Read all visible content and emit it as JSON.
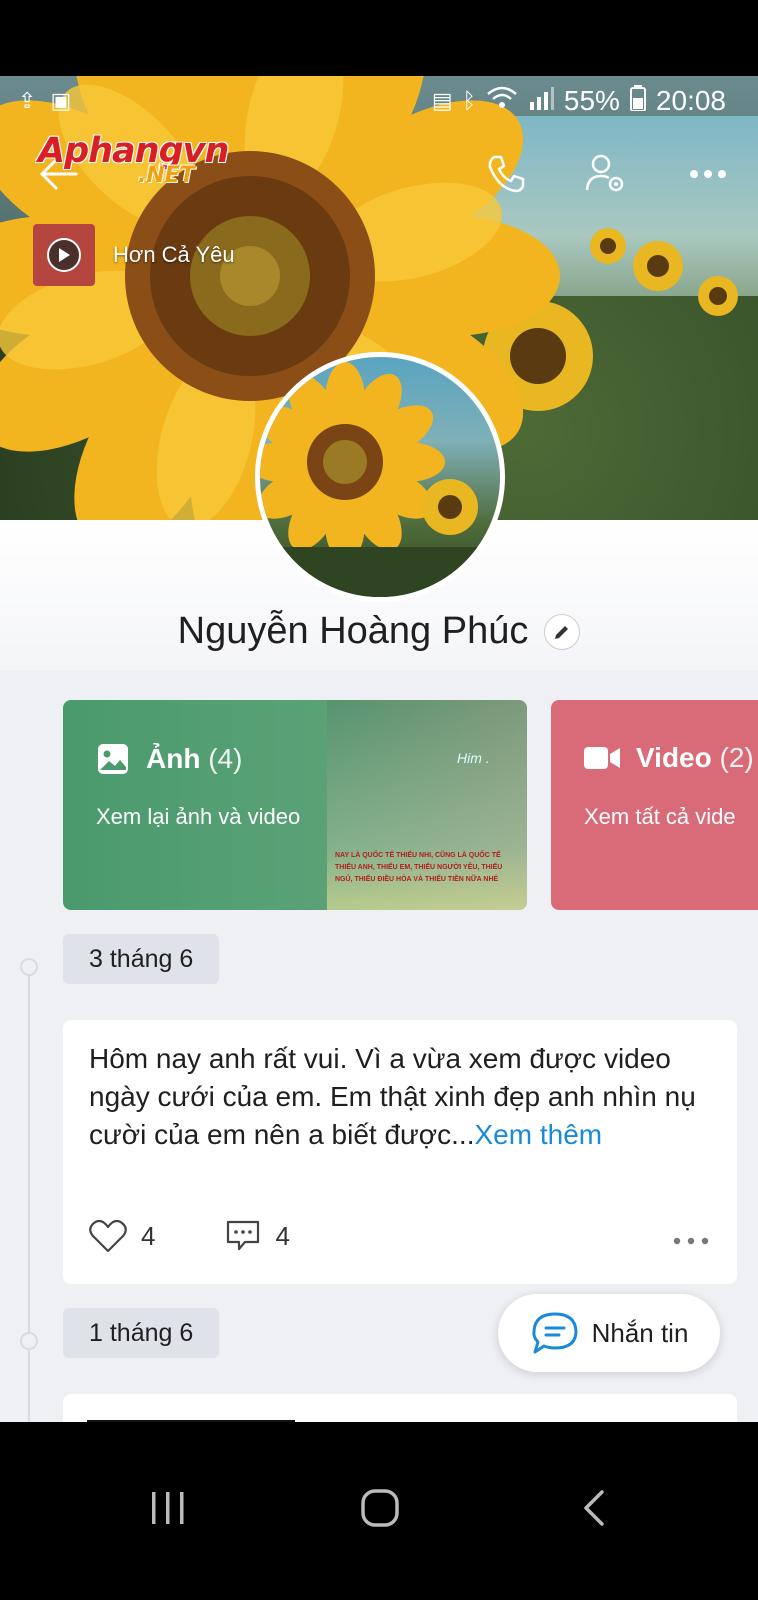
{
  "watermark": {
    "line1": "Aphangvn",
    "line2": ".NET"
  },
  "status_bar": {
    "battery": "55%",
    "time": "20:08"
  },
  "header": {
    "back_icon": "arrow-left-icon",
    "call_icon": "phone-icon",
    "settings_icon": "user-settings-icon",
    "more_icon": "more-icon"
  },
  "music": {
    "title": "Hơn Cả Yêu",
    "thumb_text": "Hơn Cả Yêu"
  },
  "profile": {
    "name": "Nguyễn Hoàng Phúc"
  },
  "cards": [
    {
      "title": "Ảnh",
      "count": "(4)",
      "subtitle": "Xem lại ảnh và video",
      "icon": "image-icon",
      "color": "#4a9a6e",
      "overlay_text": "Him .",
      "overlay_caption": "NAY LÀ QUỐC TẾ THIẾU NHI, CŨNG LÀ QUỐC TẾ THIẾU ANH, THIẾU EM, THIẾU NGƯỜI YÊU, THIẾU NGỦ, THIẾU ĐIỀU HÒA VÀ THIẾU TIỀN NỮA NHÉ"
    },
    {
      "title": "Video",
      "count": "(2)",
      "subtitle": "Xem tất cả vide",
      "icon": "video-camera-icon",
      "color": "#d96b78"
    }
  ],
  "timeline": [
    {
      "date": "3 tháng 6",
      "text": "Hôm nay anh rất vui. Vì a vừa xem được video ngày cưới của em. Em thật xinh đẹp anh nhìn nụ cười của em nên a biết được...",
      "see_more": "Xem thêm",
      "likes": "4",
      "comments": "4"
    },
    {
      "date": "1 tháng 6"
    }
  ],
  "message_button": {
    "label": "Nhắn tin"
  },
  "colors": {
    "link": "#1a8ad8",
    "photo_card": "#4a9a6e",
    "video_card": "#d96b78"
  }
}
